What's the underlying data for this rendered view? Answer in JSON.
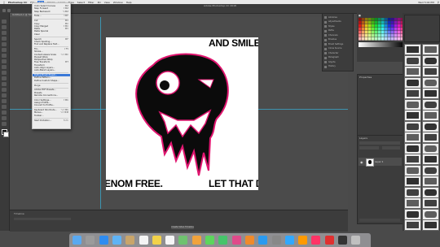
{
  "menubar": {
    "app_name": "Photoshop CC",
    "items": [
      "File",
      "Edit",
      "Image",
      "Layer",
      "Type",
      "Select",
      "Filter",
      "3D",
      "View",
      "Window",
      "Help"
    ],
    "status_right": [
      "Wed 5:04 PM"
    ]
  },
  "window": {
    "title": "Adobe Photoshop CC 2018"
  },
  "document_tab": {
    "label": "Untitled-1 @ 50% (Layer 1, RGB/8)"
  },
  "image_menu": {
    "items": [
      {
        "label": "Undo Select Canvas",
        "shortcut": "⌘Z"
      },
      {
        "label": "Step Forward",
        "shortcut": "⇧⌘Z"
      },
      {
        "label": "Step Backward",
        "shortcut": "⌥⌘Z"
      },
      {
        "sep": true
      },
      {
        "label": "Fade...",
        "shortcut": "⇧⌘F"
      },
      {
        "sep": true
      },
      {
        "label": "Cut",
        "shortcut": "⌘X"
      },
      {
        "label": "Copy",
        "shortcut": "⌘C"
      },
      {
        "label": "Copy Merged",
        "shortcut": "⇧⌘C"
      },
      {
        "label": "Paste",
        "shortcut": "⌘V"
      },
      {
        "label": "Paste Special",
        "shortcut": ""
      },
      {
        "label": "Clear",
        "shortcut": ""
      },
      {
        "sep": true
      },
      {
        "label": "Search",
        "shortcut": "⌘F"
      },
      {
        "label": "Check Spelling...",
        "shortcut": ""
      },
      {
        "label": "Find and Replace Text...",
        "shortcut": ""
      },
      {
        "sep": true
      },
      {
        "label": "Fill...",
        "shortcut": "⇧F5"
      },
      {
        "label": "Stroke...",
        "shortcut": ""
      },
      {
        "label": "Content-Aware Scale",
        "shortcut": "⌥⇧⌘C"
      },
      {
        "label": "Puppet Warp",
        "shortcut": ""
      },
      {
        "label": "Perspective Warp",
        "shortcut": ""
      },
      {
        "label": "Free Transform",
        "shortcut": "⌘T"
      },
      {
        "label": "Transform",
        "shortcut": ""
      },
      {
        "label": "Auto-Align Layers...",
        "shortcut": ""
      },
      {
        "label": "Auto-Blend Layers...",
        "shortcut": ""
      },
      {
        "sep": true
      },
      {
        "label": "Define Brush Preset...",
        "shortcut": "",
        "selected": true
      },
      {
        "label": "Define Pattern...",
        "shortcut": ""
      },
      {
        "label": "Define Custom Shape...",
        "shortcut": ""
      },
      {
        "sep": true
      },
      {
        "label": "Purge",
        "shortcut": ""
      },
      {
        "sep": true
      },
      {
        "label": "Adobe PDF Presets...",
        "shortcut": ""
      },
      {
        "label": "Presets",
        "shortcut": ""
      },
      {
        "label": "Remote Connections...",
        "shortcut": ""
      },
      {
        "sep": true
      },
      {
        "label": "Color Settings...",
        "shortcut": "⇧⌘K"
      },
      {
        "label": "Assign Profile...",
        "shortcut": ""
      },
      {
        "label": "Convert to Profile...",
        "shortcut": ""
      },
      {
        "sep": true
      },
      {
        "label": "Keyboard Shortcuts...",
        "shortcut": "⌥⇧⌘K"
      },
      {
        "label": "Menus...",
        "shortcut": "⌥⇧⌘M"
      },
      {
        "label": "Toolbar...",
        "shortcut": ""
      },
      {
        "sep": true
      },
      {
        "label": "Start Dictation...",
        "shortcut": "fn fn"
      }
    ]
  },
  "canvas": {
    "text_top_right": "AND SMILE",
    "text_bottom_left": "ENOM FREE.",
    "text_bottom_right": "LET THAT DI"
  },
  "mid_panel": {
    "items": [
      "Libraries",
      "Adjustments",
      "Styles",
      "Paths",
      "Channels",
      "Brushes",
      "Brush Settings",
      "Clone Source",
      "Character",
      "Paragraph",
      "Glyphs",
      "History"
    ]
  },
  "properties_panel": {
    "tab": "Properties"
  },
  "layers_panel": {
    "tab": "Layers",
    "layer_name": "Layer 1"
  },
  "timeline": {
    "label": "Timeline",
    "render_button": "Create Video Timeline"
  },
  "colors": {
    "selection": "#3a79d8",
    "guide": "#3aa6c9",
    "skull": "#0b0b0b",
    "skull_outline": "#e0156f"
  },
  "dock": {
    "apps": [
      "finder-icon",
      "launchpad-icon",
      "safari-icon",
      "mail-icon",
      "contacts-icon",
      "calendar-icon",
      "notes-icon",
      "reminders-icon",
      "maps-icon",
      "photos-icon",
      "messages-icon",
      "facetime-icon",
      "itunes-icon",
      "ibooks-icon",
      "app-store-icon",
      "system-preferences-icon",
      "photoshop-icon",
      "illustrator-icon",
      "indesign-icon",
      "acrobat-icon",
      "eps-icon",
      "trash-icon"
    ]
  }
}
